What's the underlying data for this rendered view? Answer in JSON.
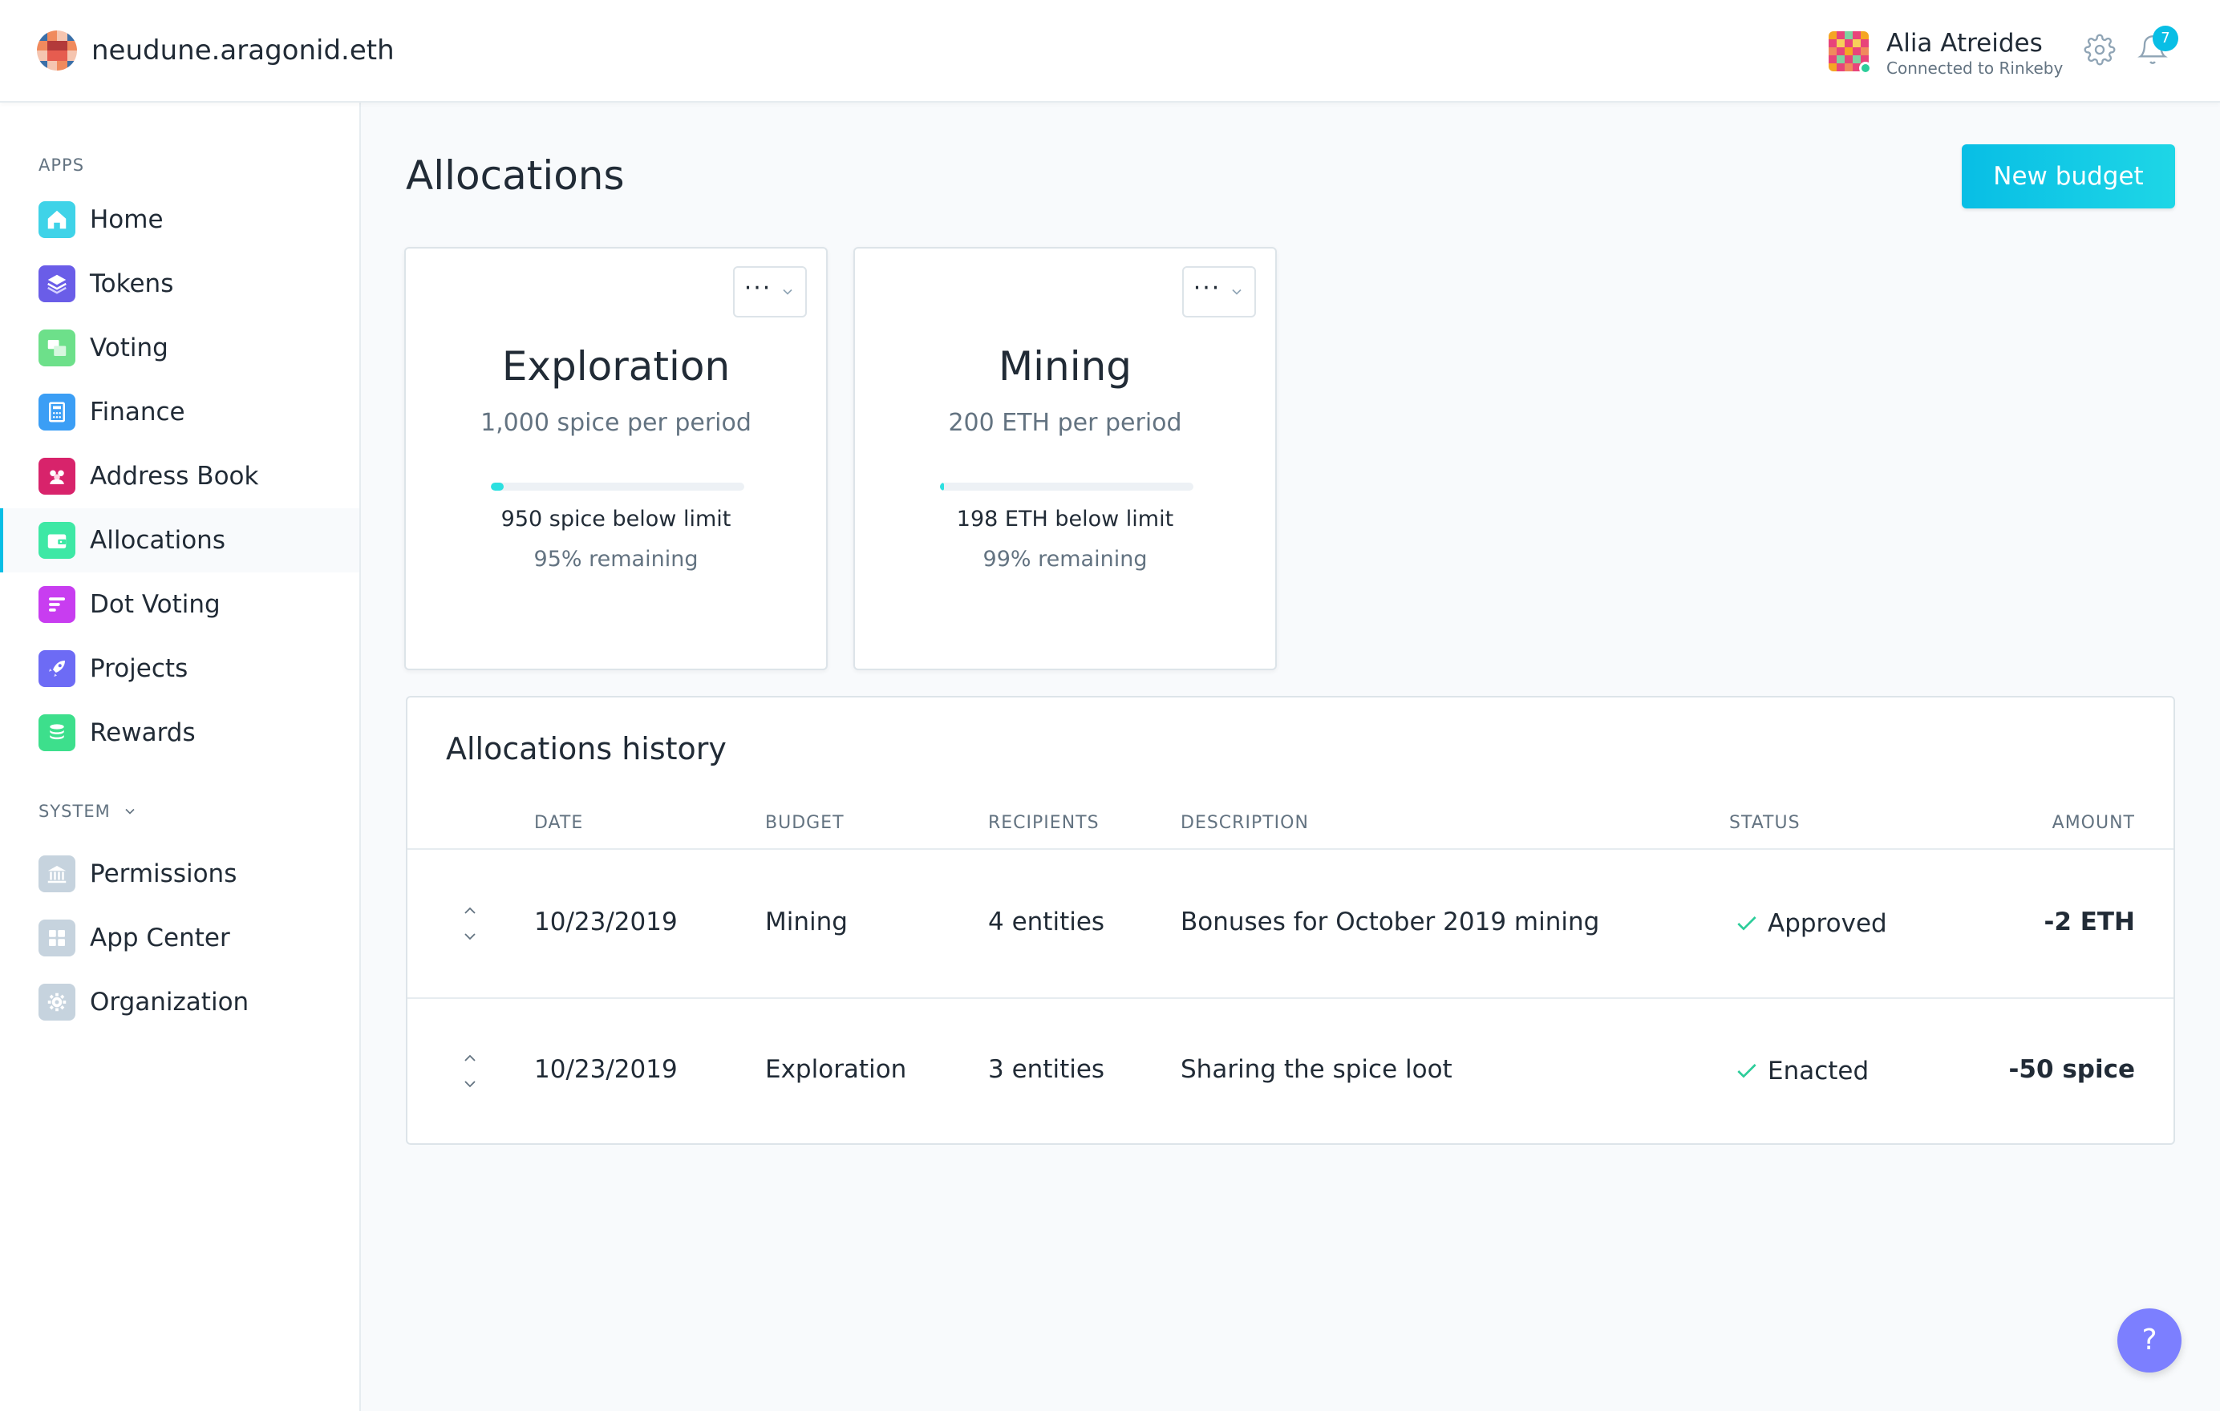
{
  "header": {
    "org_name": "neudune.aragonid.eth",
    "user_name": "Alia Atreides",
    "network": "Connected to Rinkeby",
    "notification_count": "7"
  },
  "sidebar": {
    "apps_label": "APPS",
    "system_label": "SYSTEM",
    "apps": [
      {
        "label": "Home",
        "icon": "home-icon",
        "color": "#3fd3e8"
      },
      {
        "label": "Tokens",
        "icon": "tokens-icon",
        "color": "#6a5de8"
      },
      {
        "label": "Voting",
        "icon": "voting-icon",
        "color": "#6de08a"
      },
      {
        "label": "Finance",
        "icon": "finance-icon",
        "color": "#3b9ef5"
      },
      {
        "label": "Address Book",
        "icon": "address-book-icon",
        "color": "#d8236b"
      },
      {
        "label": "Allocations",
        "icon": "allocations-icon",
        "color": "#3ee8a5"
      },
      {
        "label": "Dot Voting",
        "icon": "dot-voting-icon",
        "color": "#c83df0"
      },
      {
        "label": "Projects",
        "icon": "projects-icon",
        "color": "#6d6bf5"
      },
      {
        "label": "Rewards",
        "icon": "rewards-icon",
        "color": "#3ddf8c"
      }
    ],
    "system": [
      {
        "label": "Permissions",
        "icon": "permissions-icon"
      },
      {
        "label": "App Center",
        "icon": "app-center-icon"
      },
      {
        "label": "Organization",
        "icon": "organization-icon"
      }
    ],
    "active_item": "Allocations"
  },
  "main": {
    "title": "Allocations",
    "new_budget_label": "New budget",
    "budgets": [
      {
        "name": "Exploration",
        "per_period": "1,000 spice per period",
        "below_limit": "950 spice below limit",
        "remaining": "95% remaining",
        "spent_fraction": 0.05,
        "menu_label": "···"
      },
      {
        "name": "Mining",
        "per_period": "200 ETH per period",
        "below_limit": "198 ETH below limit",
        "remaining": "99% remaining",
        "spent_fraction": 0.01,
        "menu_label": "···"
      }
    ],
    "history": {
      "title": "Allocations history",
      "columns": [
        "DATE",
        "BUDGET",
        "RECIPIENTS",
        "DESCRIPTION",
        "STATUS",
        "AMOUNT"
      ],
      "rows": [
        {
          "date": "10/23/2019",
          "budget": "Mining",
          "recipients": "4 entities",
          "description": "Bonuses for October 2019 mining",
          "status": "Approved",
          "amount": "-2 ETH"
        },
        {
          "date": "10/23/2019",
          "budget": "Exploration",
          "recipients": "3 entities",
          "description": "Sharing the spice loot",
          "status": "Enacted",
          "amount": "-50 spice"
        }
      ]
    },
    "help_label": "?"
  },
  "colors": {
    "accent": "#08bee5",
    "success": "#2ccd9a",
    "help": "#7c7fff"
  }
}
